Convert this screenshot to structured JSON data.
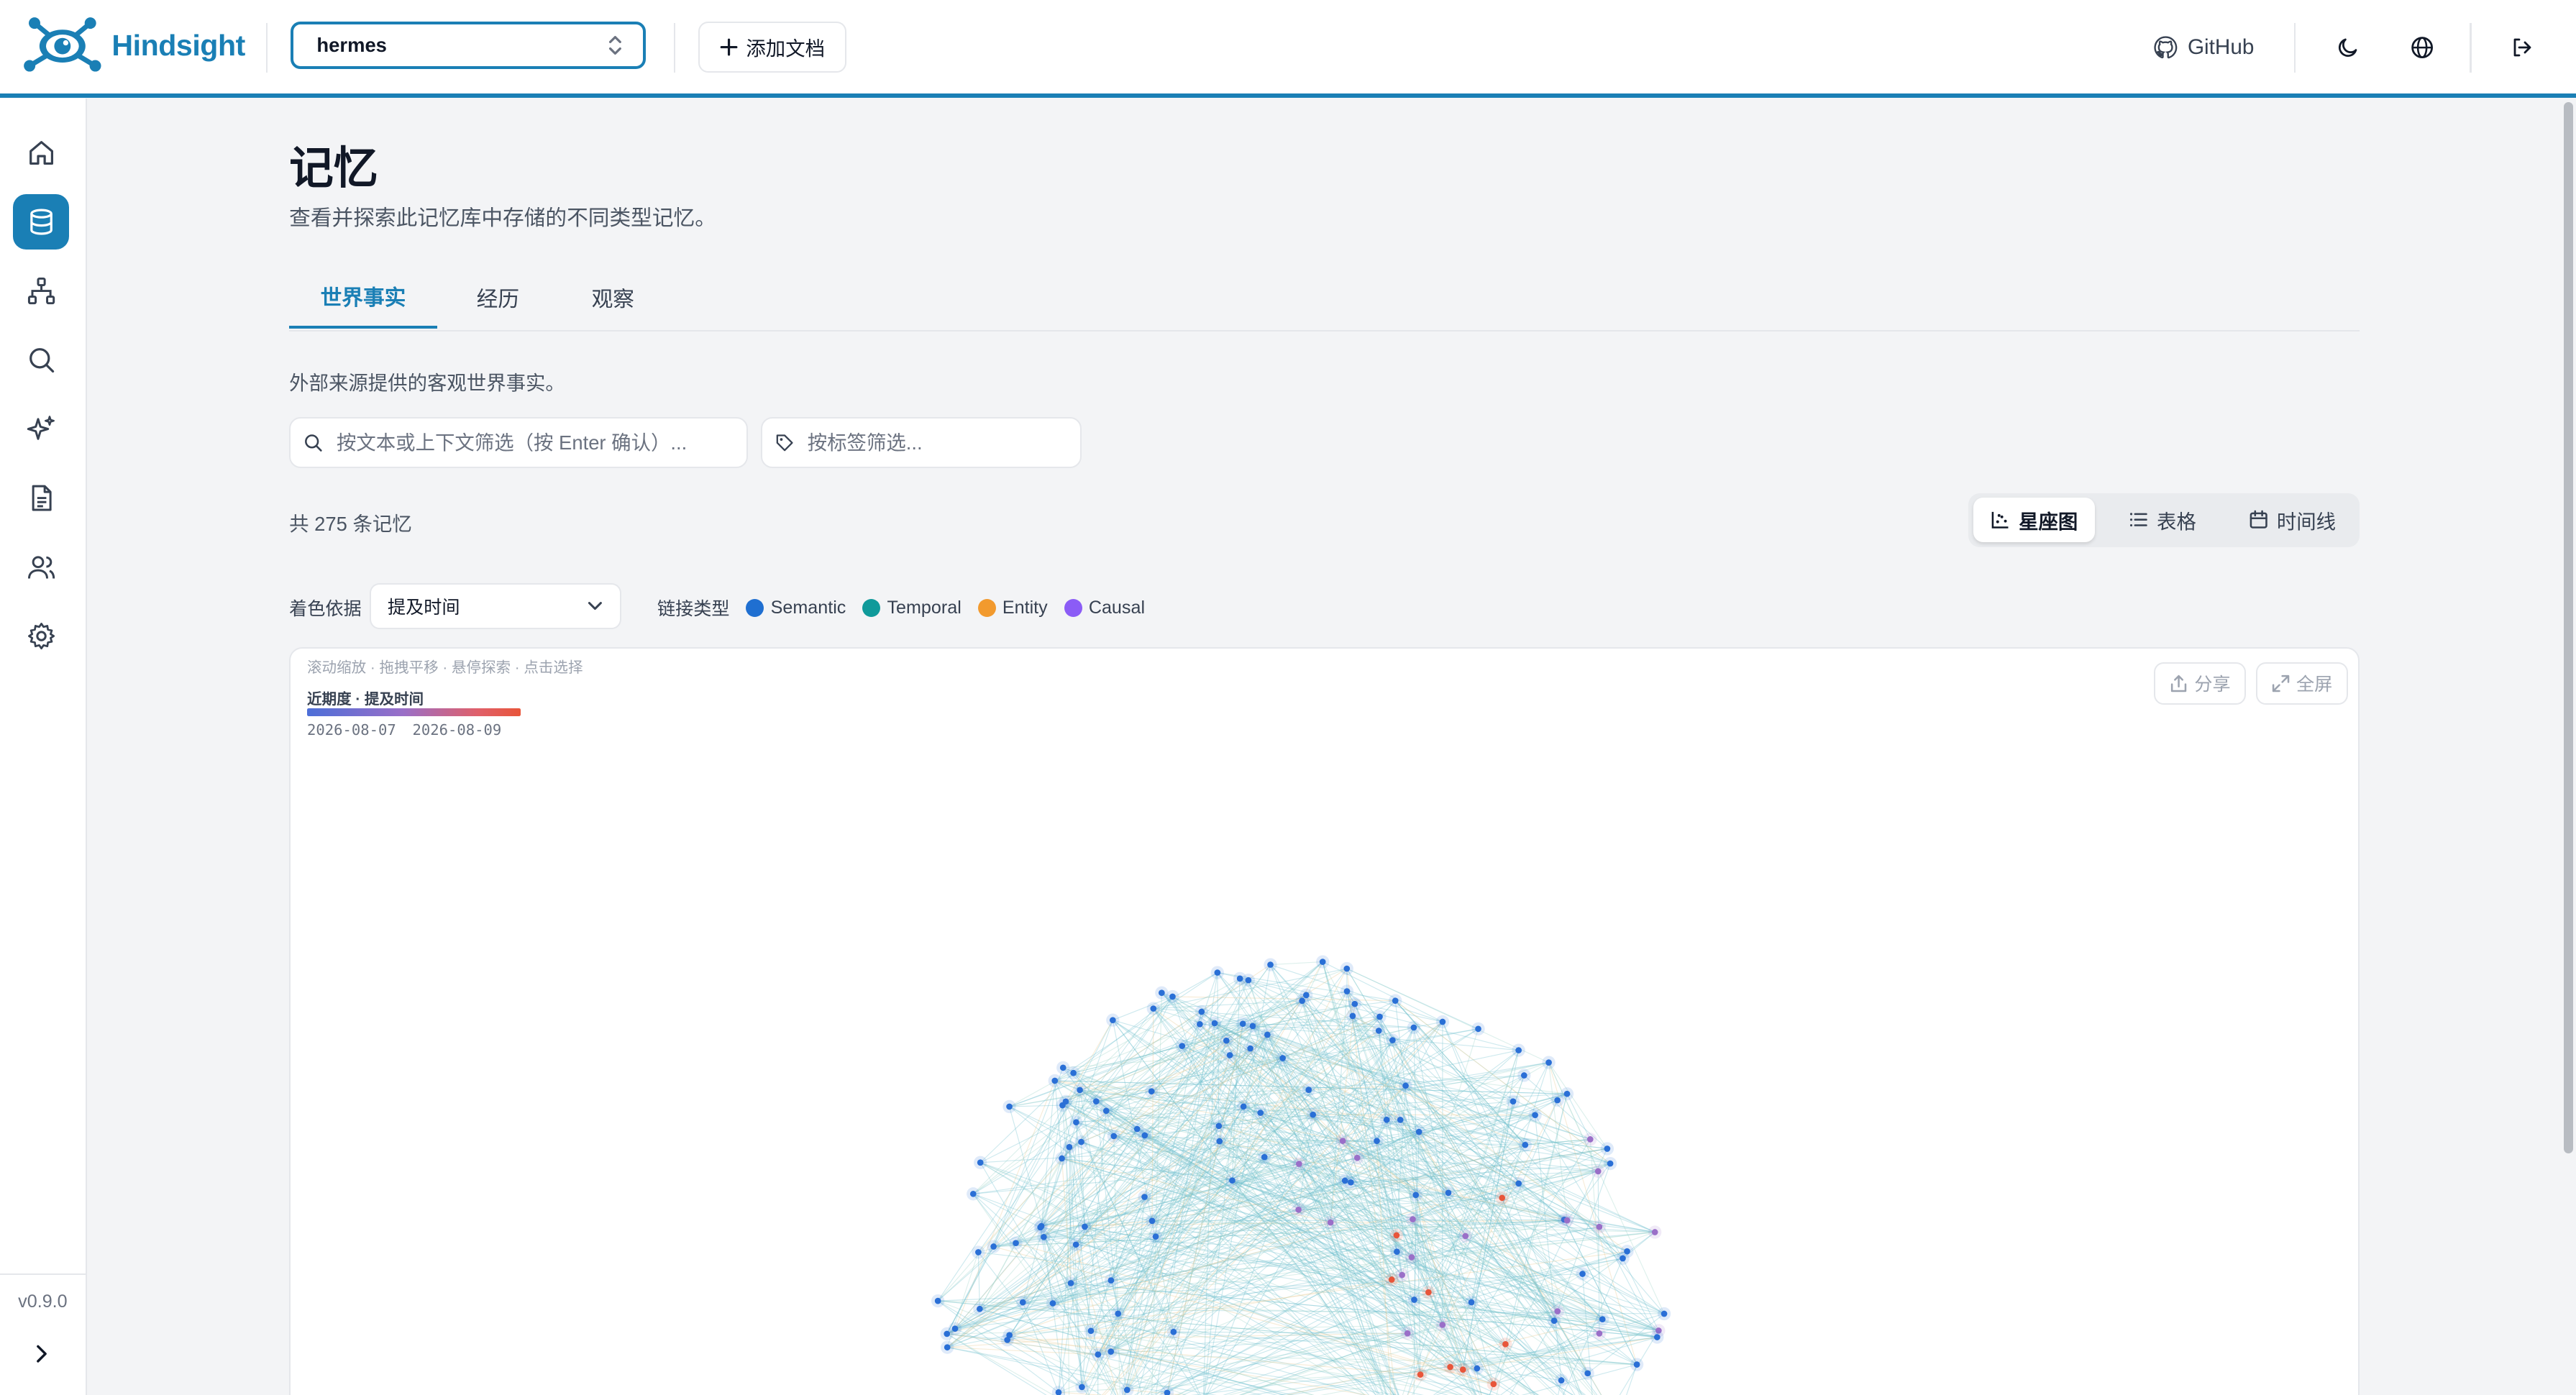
{
  "app": {
    "name": "Hindsight",
    "bank_selector": "hermes",
    "add_document": "添加文档",
    "github": "GitHub",
    "version": "v0.9.0"
  },
  "sidebar": {
    "items": [
      {
        "icon": "home-icon"
      },
      {
        "icon": "database-icon",
        "active": true
      },
      {
        "icon": "hierarchy-icon"
      },
      {
        "icon": "search-icon"
      },
      {
        "icon": "sparkles-icon"
      },
      {
        "icon": "document-icon"
      },
      {
        "icon": "users-icon"
      },
      {
        "icon": "gear-icon"
      }
    ]
  },
  "page": {
    "title": "记忆",
    "subtitle": "查看并探索此记忆库中存储的不同类型记忆。"
  },
  "tabs": [
    {
      "label": "世界事实",
      "active": true
    },
    {
      "label": "经历"
    },
    {
      "label": "观察"
    }
  ],
  "section": {
    "description": "外部来源提供的客观世界事实。",
    "search_placeholder": "按文本或上下文筛选（按 Enter 确认）...",
    "tag_placeholder": "按标签筛选...",
    "count": "共 275 条记忆"
  },
  "views": [
    {
      "label": "星座图",
      "icon": "scatter-icon",
      "active": true
    },
    {
      "label": "表格",
      "icon": "list-icon"
    },
    {
      "label": "时间线",
      "icon": "calendar-icon"
    }
  ],
  "controls": {
    "color_by_label": "着色依据",
    "color_by_value": "提及时间",
    "link_type_label": "链接类型",
    "link_types": [
      {
        "label": "Semantic",
        "color": "#1f6fd1"
      },
      {
        "label": "Temporal",
        "color": "#0f9a9a"
      },
      {
        "label": "Entity",
        "color": "#f29a2e"
      },
      {
        "label": "Causal",
        "color": "#8b5cf6"
      }
    ]
  },
  "graph": {
    "hints": "滚动缩放 · 拖拽平移 · 悬停探索 · 点击选择",
    "recency_title": "近期度 · 提及时间",
    "date_start": "2026-08-07",
    "date_end": "2026-08-09",
    "share": "分享",
    "fullscreen": "全屏",
    "colors": {
      "semantic_edge": "#6fbfcf",
      "temporal_edge": "#9fd3c8",
      "entity_edge": "#e9c88f",
      "node_old": "#2a6fd6",
      "node_mid": "#9a6fc8",
      "node_new": "#e8553a"
    }
  },
  "colors": {
    "accent": "#1a7fb5",
    "page_bg": "#f3f4f6"
  }
}
